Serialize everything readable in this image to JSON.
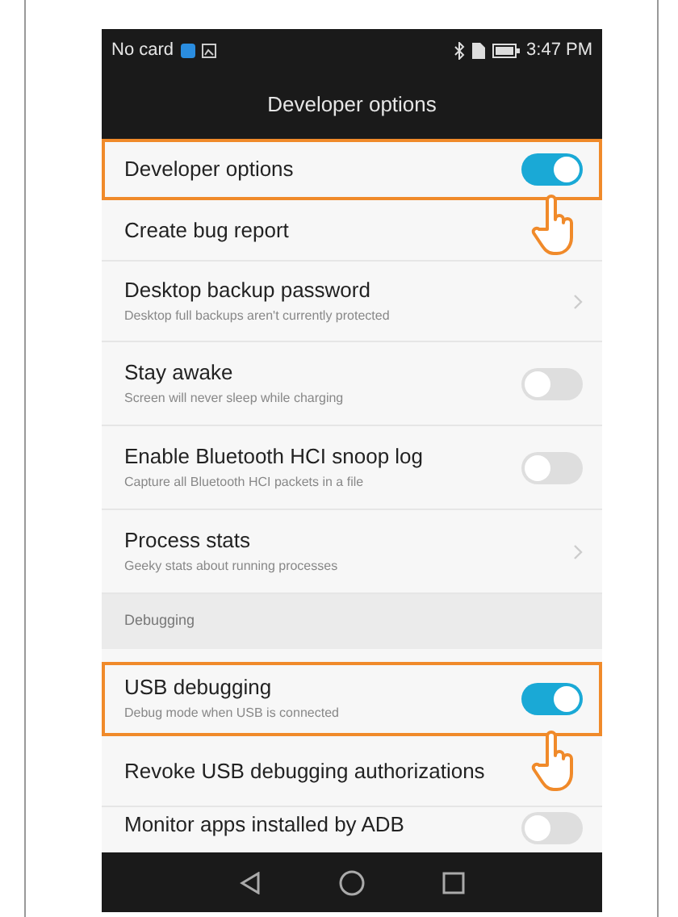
{
  "status_bar": {
    "carrier": "No card",
    "time": "3:47 PM"
  },
  "title": "Developer options",
  "items": [
    {
      "kind": "toggle",
      "title": "Developer options",
      "on": true,
      "highlighted": true
    },
    {
      "kind": "plain",
      "title": "Create bug report",
      "highlighted": false
    },
    {
      "kind": "chevron",
      "title": "Desktop backup password",
      "subtitle": "Desktop full backups aren't currently protected",
      "highlighted": false
    },
    {
      "kind": "toggle",
      "title": "Stay awake",
      "subtitle": "Screen will never sleep while charging",
      "on": false,
      "highlighted": false
    },
    {
      "kind": "toggle",
      "title": "Enable Bluetooth HCI snoop log",
      "subtitle": "Capture all Bluetooth HCI packets in a file",
      "on": false,
      "highlighted": false
    },
    {
      "kind": "chevron",
      "title": "Process stats",
      "subtitle": "Geeky stats about running processes",
      "highlighted": false
    },
    {
      "kind": "header",
      "title": "Debugging"
    },
    {
      "kind": "toggle",
      "title": "USB debugging",
      "subtitle": "Debug mode when USB is connected",
      "on": true,
      "highlighted": true
    },
    {
      "kind": "plain",
      "title": "Revoke USB debugging authorizations",
      "highlighted": false
    },
    {
      "kind": "toggle",
      "title": "Monitor apps installed by ADB",
      "on": false,
      "highlighted": false
    }
  ]
}
